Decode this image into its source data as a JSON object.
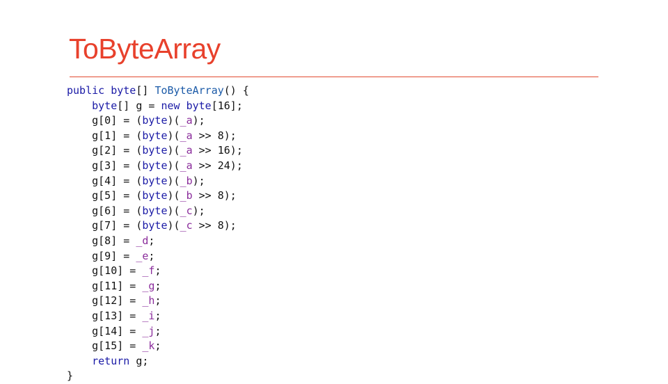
{
  "slide": {
    "title": "ToByteArray",
    "accent_color": "#e8412c"
  },
  "code": {
    "lines": [
      [
        {
          "t": "public byte",
          "c": "kw"
        },
        {
          "t": "[] "
        },
        {
          "t": "ToByteArray",
          "c": "fn"
        },
        {
          "t": "() {"
        }
      ],
      [
        {
          "t": "    "
        },
        {
          "t": "byte",
          "c": "kw"
        },
        {
          "t": "[] g = "
        },
        {
          "t": "new byte",
          "c": "kw"
        },
        {
          "t": "[16];"
        }
      ],
      [
        {
          "t": "    g[0] = ("
        },
        {
          "t": "byte",
          "c": "kw"
        },
        {
          "t": ")("
        },
        {
          "t": "_a",
          "c": "fld"
        },
        {
          "t": ");"
        }
      ],
      [
        {
          "t": "    g[1] = ("
        },
        {
          "t": "byte",
          "c": "kw"
        },
        {
          "t": ")("
        },
        {
          "t": "_a",
          "c": "fld"
        },
        {
          "t": " >> 8);"
        }
      ],
      [
        {
          "t": "    g[2] = ("
        },
        {
          "t": "byte",
          "c": "kw"
        },
        {
          "t": ")("
        },
        {
          "t": "_a",
          "c": "fld"
        },
        {
          "t": " >> 16);"
        }
      ],
      [
        {
          "t": "    g[3] = ("
        },
        {
          "t": "byte",
          "c": "kw"
        },
        {
          "t": ")("
        },
        {
          "t": "_a",
          "c": "fld"
        },
        {
          "t": " >> 24);"
        }
      ],
      [
        {
          "t": "    g[4] = ("
        },
        {
          "t": "byte",
          "c": "kw"
        },
        {
          "t": ")("
        },
        {
          "t": "_b",
          "c": "fld"
        },
        {
          "t": ");"
        }
      ],
      [
        {
          "t": "    g[5] = ("
        },
        {
          "t": "byte",
          "c": "kw"
        },
        {
          "t": ")("
        },
        {
          "t": "_b",
          "c": "fld"
        },
        {
          "t": " >> 8);"
        }
      ],
      [
        {
          "t": "    g[6] = ("
        },
        {
          "t": "byte",
          "c": "kw"
        },
        {
          "t": ")("
        },
        {
          "t": "_c",
          "c": "fld"
        },
        {
          "t": ");"
        }
      ],
      [
        {
          "t": "    g[7] = ("
        },
        {
          "t": "byte",
          "c": "kw"
        },
        {
          "t": ")("
        },
        {
          "t": "_c",
          "c": "fld"
        },
        {
          "t": " >> 8);"
        }
      ],
      [
        {
          "t": "    g[8] = "
        },
        {
          "t": "_d",
          "c": "fld"
        },
        {
          "t": ";"
        }
      ],
      [
        {
          "t": "    g[9] = "
        },
        {
          "t": "_e",
          "c": "fld"
        },
        {
          "t": ";"
        }
      ],
      [
        {
          "t": "    g[10] = "
        },
        {
          "t": "_f",
          "c": "fld"
        },
        {
          "t": ";"
        }
      ],
      [
        {
          "t": "    g[11] = "
        },
        {
          "t": "_g",
          "c": "fld"
        },
        {
          "t": ";"
        }
      ],
      [
        {
          "t": "    g[12] = "
        },
        {
          "t": "_h",
          "c": "fld"
        },
        {
          "t": ";"
        }
      ],
      [
        {
          "t": "    g[13] = "
        },
        {
          "t": "_i",
          "c": "fld"
        },
        {
          "t": ";"
        }
      ],
      [
        {
          "t": "    g[14] = "
        },
        {
          "t": "_j",
          "c": "fld"
        },
        {
          "t": ";"
        }
      ],
      [
        {
          "t": "    g[15] = "
        },
        {
          "t": "_k",
          "c": "fld"
        },
        {
          "t": ";"
        }
      ],
      [
        {
          "t": "    "
        },
        {
          "t": "return",
          "c": "kw"
        },
        {
          "t": " g;"
        }
      ],
      [
        {
          "t": "}"
        }
      ]
    ]
  }
}
